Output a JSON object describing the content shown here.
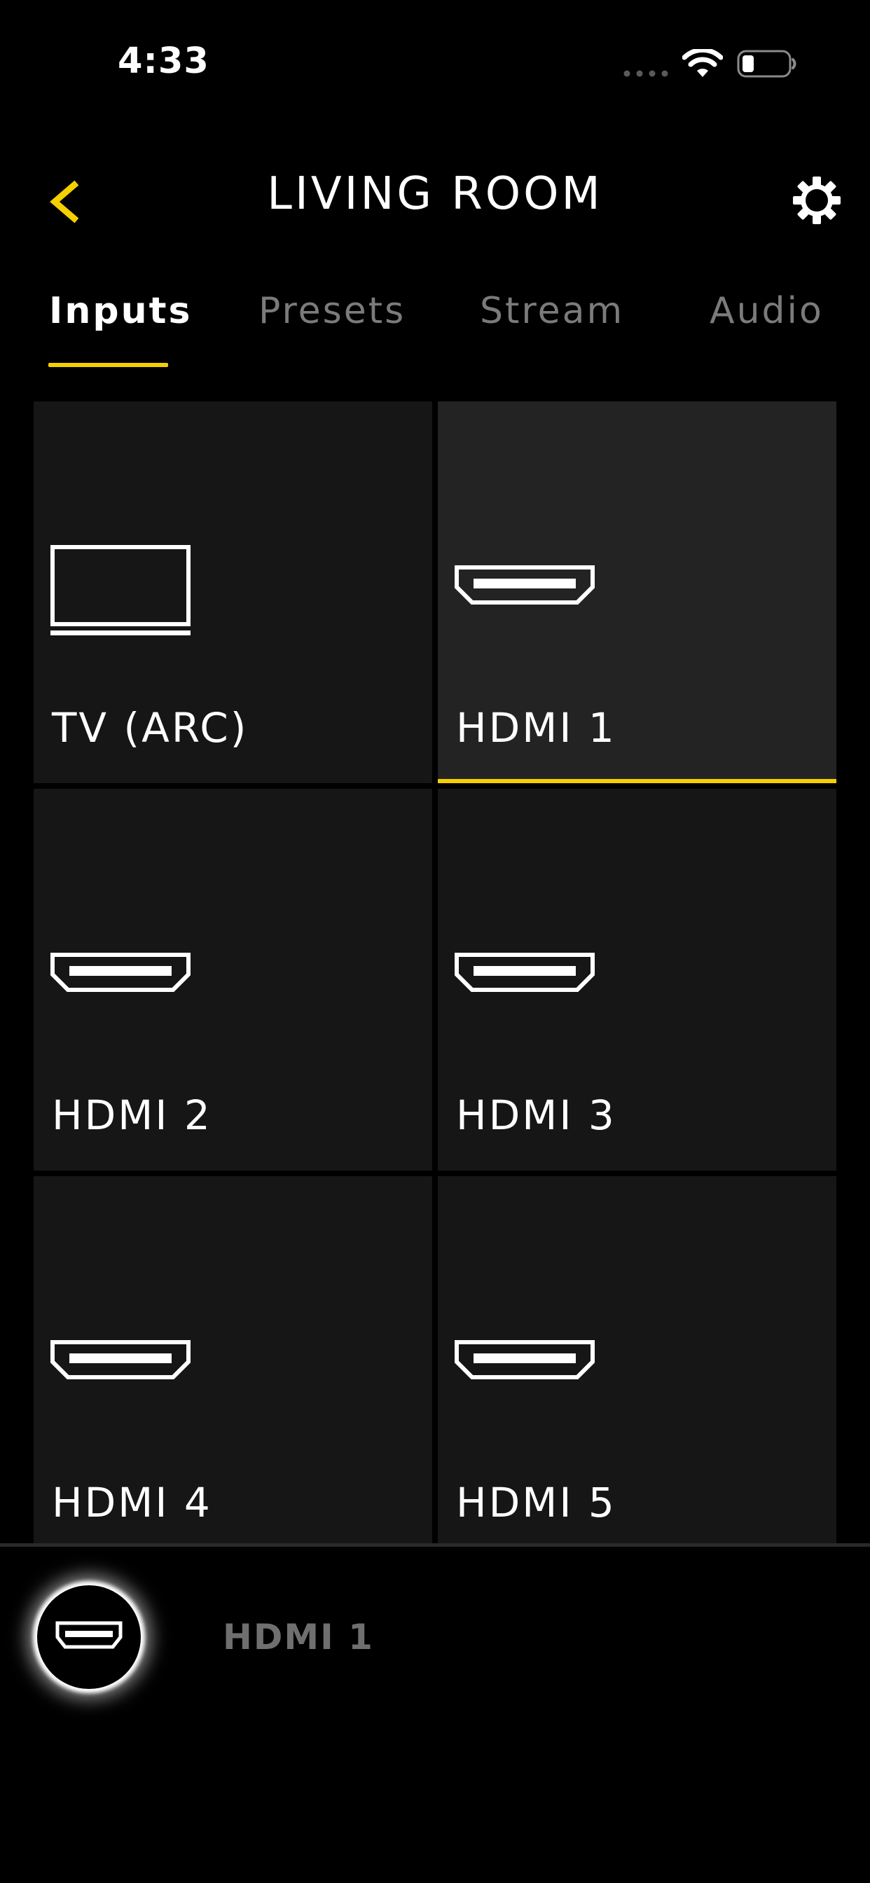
{
  "status_bar": {
    "time": "4:33",
    "icons": [
      "cellular-signal-icon",
      "wifi-icon",
      "battery-icon"
    ]
  },
  "header": {
    "title": "LIVING ROOM",
    "back_icon": "chevron-left-icon",
    "settings_icon": "gear-icon"
  },
  "tabs": [
    {
      "label": "Inputs",
      "active": true
    },
    {
      "label": "Presets",
      "active": false
    },
    {
      "label": "Stream",
      "active": false
    },
    {
      "label": "Audio",
      "active": false
    }
  ],
  "inputs": [
    {
      "label": "TV (ARC)",
      "icon": "tv-icon",
      "selected": false
    },
    {
      "label": "HDMI 1",
      "icon": "hdmi-icon",
      "selected": true
    },
    {
      "label": "HDMI 2",
      "icon": "hdmi-icon",
      "selected": false
    },
    {
      "label": "HDMI 3",
      "icon": "hdmi-icon",
      "selected": false
    },
    {
      "label": "HDMI 4",
      "icon": "hdmi-icon",
      "selected": false
    },
    {
      "label": "HDMI 5",
      "icon": "hdmi-icon",
      "selected": false
    }
  ],
  "now_playing": {
    "source_label": "HDMI 1",
    "source_icon": "hdmi-icon"
  },
  "colors": {
    "background": "#000000",
    "tile": "#161616",
    "tile_selected": "#232323",
    "accent": "#f5d000",
    "inactive_text": "#7b7b7b",
    "now_playing_text": "#6f6f6f"
  }
}
